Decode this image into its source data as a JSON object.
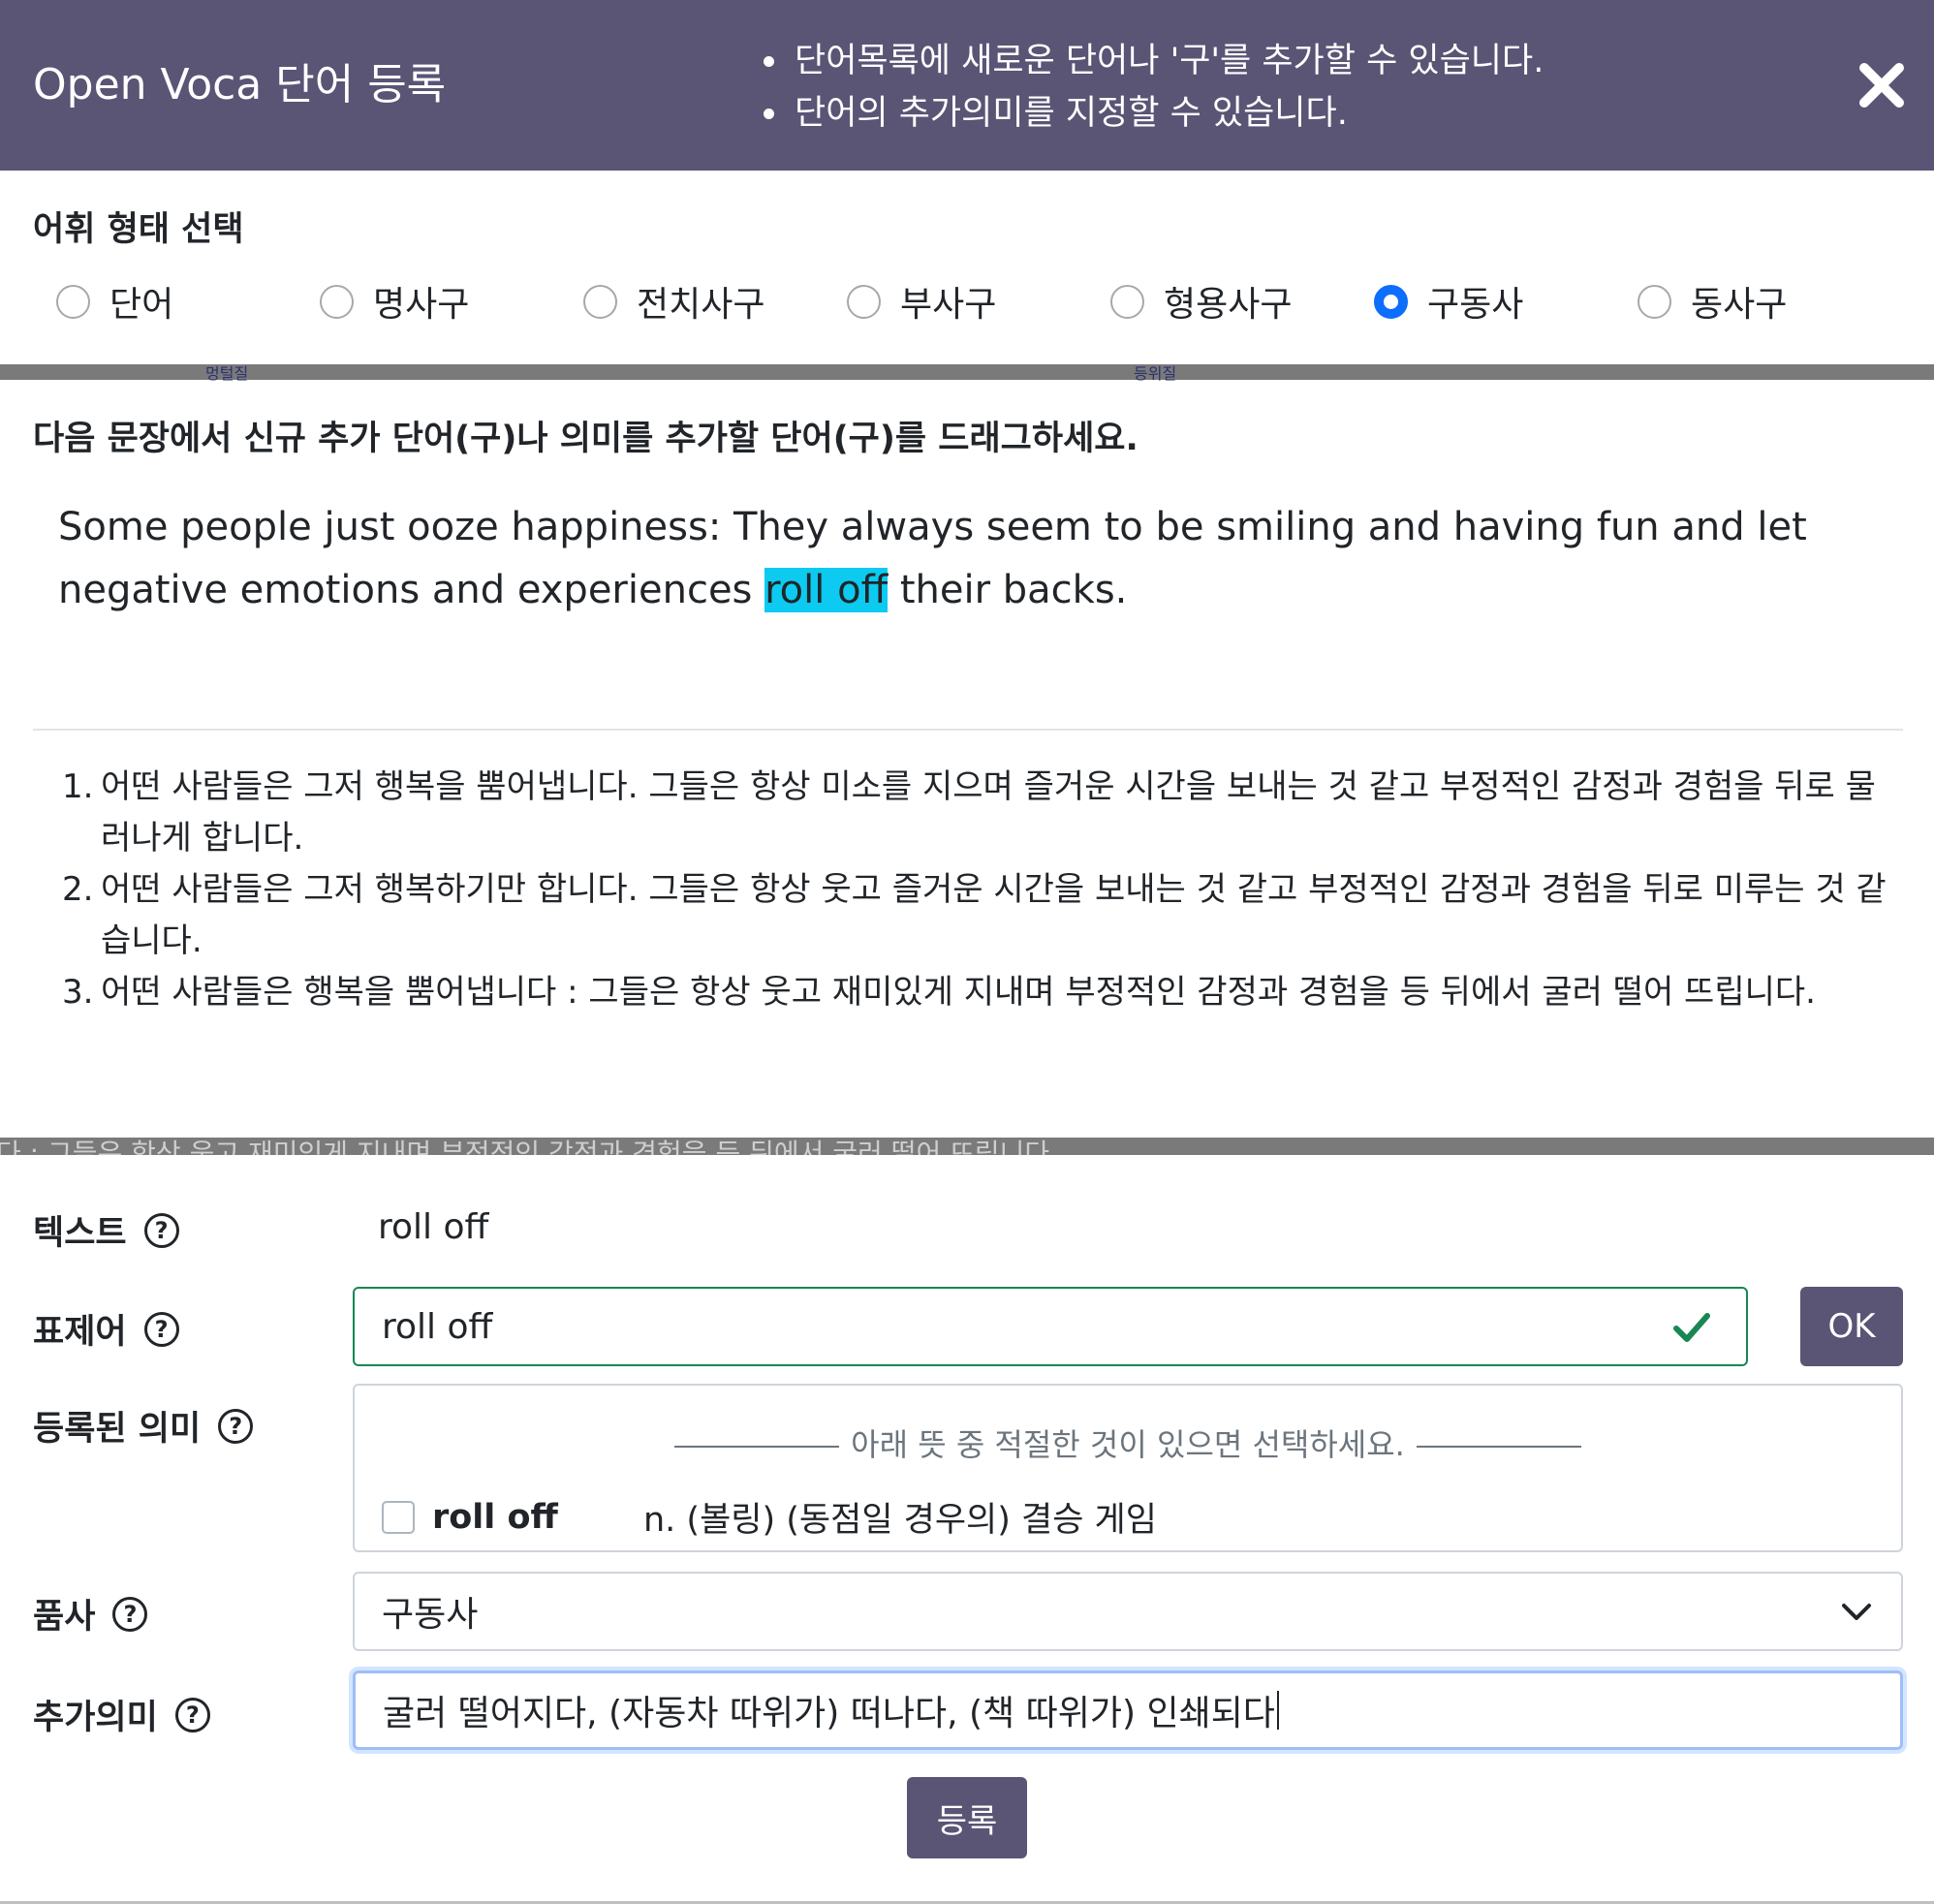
{
  "header": {
    "title": "Open Voca 단어 등록",
    "notes": [
      "단어목록에 새로운 단어나 '구'를 추가할 수 있습니다.",
      "단어의 추가의미를 지정할 수 있습니다."
    ],
    "close_icon": "close-icon"
  },
  "vocab_type": {
    "label": "어휘 형태 선택",
    "options": [
      {
        "label": "단어",
        "checked": false
      },
      {
        "label": "명사구",
        "checked": false
      },
      {
        "label": "전치사구",
        "checked": false
      },
      {
        "label": "부사구",
        "checked": false
      },
      {
        "label": "형용사구",
        "checked": false
      },
      {
        "label": "구동사",
        "checked": true
      },
      {
        "label": "동사구",
        "checked": false
      }
    ],
    "overlay_tiny_1": "멍털질",
    "overlay_tiny_2": "등위질"
  },
  "sentence": {
    "instruction": "다음 문장에서 신규 추가 단어(구)나 의미를 추가할 단어(구)를 드래그하세요.",
    "before": "Some people just ooze happiness: They always seem to be smiling and having fun and let negative emotions and experiences ",
    "highlight": "roll off",
    "after": " their backs."
  },
  "translations": [
    {
      "num": "1.",
      "text": "어떤 사람들은 그저 행복을 뿜어냅니다. 그들은 항상 미소를 지으며 즐거운 시간을 보내는 것 같고 부정적인 감정과 경험을 뒤로 물러나게 합니다."
    },
    {
      "num": "2.",
      "text": "어떤 사람들은 그저 행복하기만 합니다. 그들은 항상 웃고 즐거운 시간을 보내는 것 같고 부정적인 감정과 경험을 뒤로 미루는 것 같습니다."
    },
    {
      "num": "3.",
      "text": "어떤 사람들은 행복을 뿜어냅니다 : 그들은 항상 웃고 재미있게 지내며 부정적인 감정과 경험을 등 뒤에서 굴러 떨어 뜨립니다."
    }
  ],
  "overlay_text": "다 : 그들은 항상 웃고 재미있게 지내며 부정적인 감정과 경험을 등 뒤에서 굴러 떨어 뜨립니다.",
  "form": {
    "text_label": "텍스트",
    "text_value": "roll off",
    "headword_label": "표제어",
    "headword_value": "roll off",
    "ok_label": "OK",
    "meanings_label": "등록된 의미",
    "meanings_hint": "아래 뜻 중 적절한 것이 있으면 선택하세요.",
    "meanings": [
      {
        "word": "roll off",
        "definition": "n. (볼링) (동점일 경우의) 결승 게임",
        "checked": false
      }
    ],
    "pos_label": "품사",
    "pos_value": "구동사",
    "extra_label": "추가의미",
    "extra_value": "굴러 떨어지다, (자동차 따위가) 떠나다, (책 따위가) 인쇄되다",
    "submit_label": "등록",
    "help_glyph": "?"
  },
  "colors": {
    "header_bg": "#5a5475",
    "highlight": "#0dcaf0",
    "radio_checked": "#0d6efd",
    "valid": "#198754",
    "button_bg": "#5a5475"
  }
}
